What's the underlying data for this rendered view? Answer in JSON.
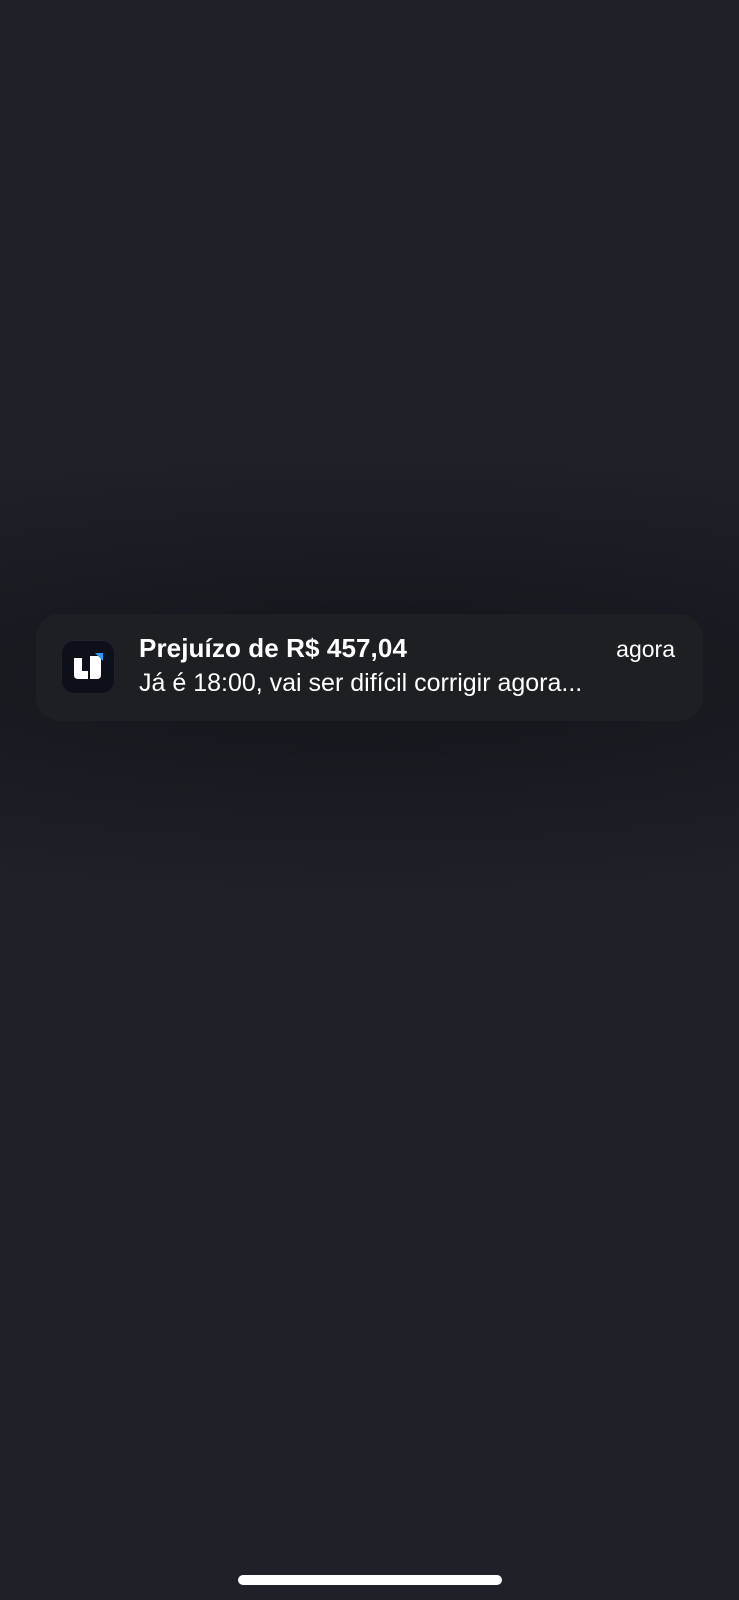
{
  "notification": {
    "app_icon": "app-logo-u-icon",
    "title": "Prejuízo de R$ 457,04",
    "time": "agora",
    "body": "Já é 18:00, vai ser difícil corrigir agora..."
  },
  "colors": {
    "background": "#1f2028",
    "card": "#1e1f22",
    "icon_background": "#0d1018",
    "icon_accent": "#2f9bff",
    "text": "#ffffff"
  }
}
